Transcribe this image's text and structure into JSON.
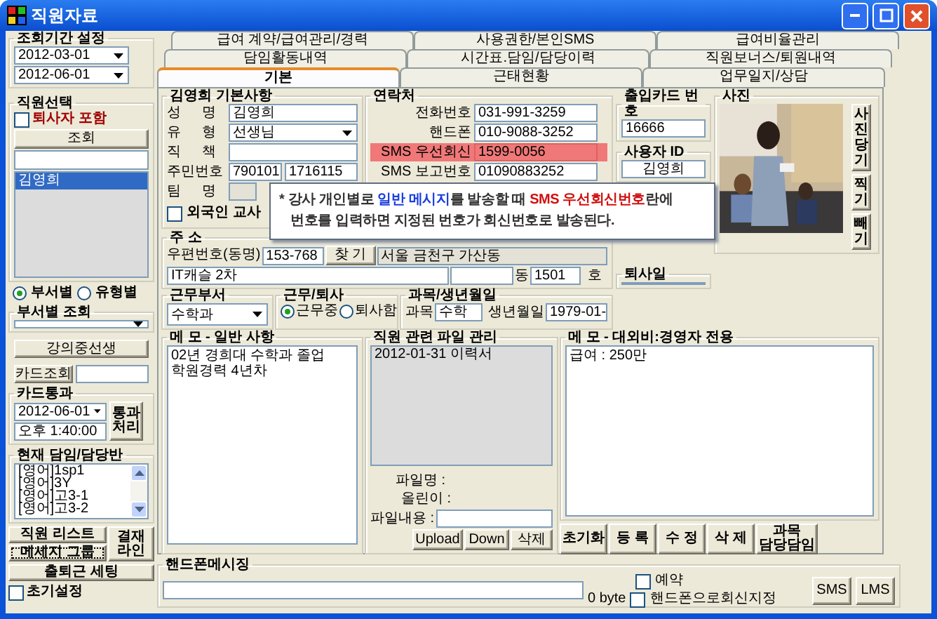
{
  "window": {
    "title": "직원자료"
  },
  "period": {
    "legend": "조회기간 설정",
    "from": "2012-03-01",
    "to": "2012-06-01"
  },
  "staff": {
    "legend": "직원선택",
    "include_retired": {
      "label": "퇴사자 포함",
      "checked": false
    },
    "search_button": "조회",
    "list": [
      {
        "name": "김영희",
        "selected": true
      }
    ]
  },
  "group_by": [
    {
      "label": "부서별",
      "selected": true
    },
    {
      "label": "유형별",
      "selected": false
    }
  ],
  "dept_lookup": {
    "legend": "부서별 조회"
  },
  "lecture_button": "강의중선생",
  "card_lookup_button": "카드조회",
  "card_pass": {
    "legend": "카드통과",
    "date": "2012-06-01",
    "time": "오후 1:40:00",
    "button": [
      "통과",
      "처리"
    ]
  },
  "classes": {
    "legend": "현재 담임/담당반",
    "items": [
      "[영어]1sp1",
      "[영어]3Y",
      "[영어]고3-1",
      "[영어]고3-2"
    ]
  },
  "left_buttons": {
    "staff_list": "직원 리스트",
    "message_group": "메세지 그룹",
    "commute": "출퇴근 세팅",
    "approval": [
      "결재",
      "라인"
    ]
  },
  "initial_setting": {
    "label": "초기설정",
    "checked": false
  },
  "tab_rows": [
    [
      {
        "label": "급여 계약/급여관리/경력",
        "selected": false
      },
      {
        "label": "사용권한/본인SMS",
        "selected": false
      },
      {
        "label": "급여비율관리",
        "selected": false
      }
    ],
    [
      {
        "label": "담임활동내역",
        "selected": false
      },
      {
        "label": "시간표.담임/담당이력",
        "selected": false
      },
      {
        "label": "직원보너스/퇴원내역",
        "selected": false
      }
    ],
    [
      {
        "label": "기본",
        "selected": true
      },
      {
        "label": "근태현황",
        "selected": false
      },
      {
        "label": "업무일지/상담",
        "selected": false
      }
    ]
  ],
  "basic": {
    "legend": "김영희 기본사항",
    "name_label": "성 명",
    "name": "김영희",
    "type_label": "유 형",
    "type": "선생님",
    "position_label": "직 책",
    "id_label": "주민번호",
    "id_front": "790101",
    "id_back": "1716115",
    "team_label": "팀 명",
    "foreigner": {
      "label": "외국인",
      "checked": false
    },
    "teacher_label": "교사"
  },
  "contact": {
    "legend": "연락처",
    "rows": [
      {
        "label": "전화번호",
        "value": "031-991-3259",
        "highlighted": false
      },
      {
        "label": "핸드폰",
        "value": "010-9088-3252",
        "highlighted": false
      },
      {
        "label": "SMS 우선회신",
        "value": "1599-0056",
        "highlighted": true
      },
      {
        "label": "SMS 보고번호",
        "value": "01090883252",
        "highlighted": false
      }
    ]
  },
  "address": {
    "legend": "주 소",
    "zip_label": "우편번호(동명)",
    "zip": "153-768",
    "find_button": "찾 기",
    "city": "서울 금천구 가산동",
    "detail": "IT캐슬 2차",
    "dong_label": "동",
    "ho": "1501",
    "ho_label": "호"
  },
  "card_no": {
    "legend": "출입카드 번호",
    "value": "16666"
  },
  "user_id": {
    "legend": "사용자 ID",
    "value": "김영희"
  },
  "retire_date": {
    "legend": "퇴사일"
  },
  "photo": {
    "legend": "사진",
    "buttons": [
      "사진당기",
      "찍기",
      "빼기"
    ]
  },
  "dept": {
    "legend": "근무부서",
    "value": "수학과"
  },
  "status": {
    "legend": "근무/퇴사",
    "options": [
      {
        "label": "근무중",
        "selected": true
      },
      {
        "label": "퇴사함",
        "selected": false
      }
    ]
  },
  "subject": {
    "legend": "과목/생년월일",
    "subject_label": "과목",
    "subject": "수학",
    "birth_label": "생년월일",
    "birth": "1979-01-"
  },
  "memo": {
    "legend": "메 모 - 일반 사항",
    "lines": [
      "02년 경희대 수학과 졸업",
      "학원경력 4년차"
    ]
  },
  "files": {
    "legend": "직원 관련 파일 관리",
    "items": [
      "2012-01-31 이력서"
    ],
    "name_label": "파일명 :",
    "uploader_label": "올린이 :",
    "content_label": "파일내용 :",
    "buttons": [
      "Upload",
      "Down",
      "삭제"
    ]
  },
  "private_memo": {
    "legend": "메 모 - 대외비:경영자 전용",
    "text": "급여 : 250만",
    "buttons": [
      [
        "초기화"
      ],
      [
        "등 록"
      ],
      [
        "수 정"
      ],
      [
        "삭 제"
      ],
      [
        "과목",
        "담당담임"
      ]
    ]
  },
  "sms": {
    "legend": "핸드폰메시징",
    "bytes": "0 byte",
    "reserve": {
      "label": "예약",
      "checked": false
    },
    "reply_phone": {
      "label": "핸드폰으로회신지정",
      "checked": false
    },
    "buttons": [
      "SMS",
      "LMS"
    ]
  },
  "tooltip": {
    "lines": [
      [
        {
          "text": "* 강사 개인별로 ",
          "kind": "plain"
        },
        {
          "text": "일반 메시지",
          "kind": "link"
        },
        {
          "text": "를 발송할 때 ",
          "kind": "plain"
        },
        {
          "text": "SMS 우선회신번호",
          "kind": "alert"
        },
        {
          "text": "란에",
          "kind": "plain"
        }
      ],
      [
        {
          "text": "번호를 입력하면 지정된 번호가 회신번호로 발송된다.",
          "kind": "plain"
        }
      ]
    ]
  }
}
